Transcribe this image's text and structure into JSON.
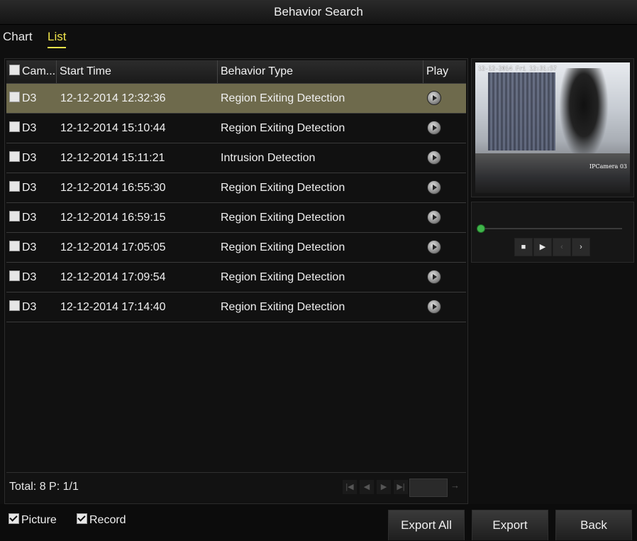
{
  "window": {
    "title": "Behavior Search"
  },
  "tabs": [
    {
      "label": "Chart"
    },
    {
      "label": "List"
    }
  ],
  "table": {
    "columns": {
      "camera": "Cam...",
      "start_time": "Start Time",
      "behavior_type": "Behavior Type",
      "play": "Play"
    },
    "rows": [
      {
        "camera": "D3",
        "start_time": "12-12-2014 12:32:36",
        "behavior_type": "Region Exiting Detection"
      },
      {
        "camera": "D3",
        "start_time": "12-12-2014 15:10:44",
        "behavior_type": "Region Exiting Detection"
      },
      {
        "camera": "D3",
        "start_time": "12-12-2014 15:11:21",
        "behavior_type": "Intrusion Detection"
      },
      {
        "camera": "D3",
        "start_time": "12-12-2014 16:55:30",
        "behavior_type": "Region Exiting Detection"
      },
      {
        "camera": "D3",
        "start_time": "12-12-2014 16:59:15",
        "behavior_type": "Region Exiting Detection"
      },
      {
        "camera": "D3",
        "start_time": "12-12-2014 17:05:05",
        "behavior_type": "Region Exiting Detection"
      },
      {
        "camera": "D3",
        "start_time": "12-12-2014 17:09:54",
        "behavior_type": "Region Exiting Detection"
      },
      {
        "camera": "D3",
        "start_time": "12-12-2014 17:14:40",
        "behavior_type": "Region Exiting Detection"
      }
    ],
    "selected_row": 1
  },
  "footer": {
    "total": "Total: 8  P: 1/1"
  },
  "preview": {
    "timestamp": "12-12-2014 Fri 12:31:57",
    "camera_label": "IPCamera 03"
  },
  "options": {
    "picture": "Picture",
    "record": "Record"
  },
  "buttons": {
    "export_all": "Export All",
    "export": "Export",
    "back": "Back"
  },
  "colors": {
    "accent": "#f0e44a",
    "selected_row": "#6e6a4c",
    "progress_knob": "#3fb54a"
  },
  "icons": {
    "play": "play-circle-icon",
    "stop": "stop-icon",
    "first": "first-page-icon",
    "prev": "prev-page-icon",
    "next": "next-page-icon",
    "last": "last-page-icon"
  }
}
